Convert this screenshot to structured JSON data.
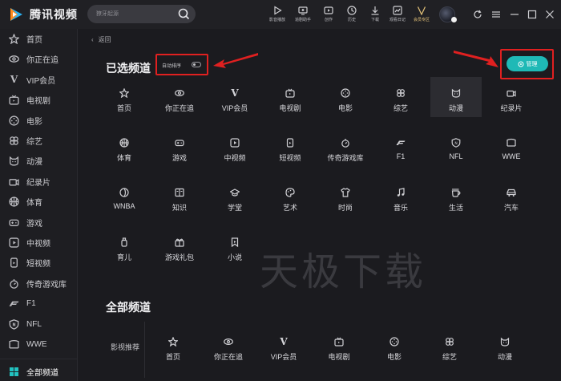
{
  "app": {
    "name": "腾讯视频"
  },
  "search": {
    "placeholder": "獠牙起源"
  },
  "toolbar": [
    {
      "icon": "play-icon",
      "label": "影音播放"
    },
    {
      "icon": "screen-record-icon",
      "label": "追剧助手"
    },
    {
      "icon": "creation-icon",
      "label": "创作"
    },
    {
      "icon": "history-icon",
      "label": "历史"
    },
    {
      "icon": "download-icon",
      "label": "下载"
    },
    {
      "icon": "moments-icon",
      "label": "观看日记"
    },
    {
      "icon": "vip-icon",
      "label": "会员专区"
    }
  ],
  "sidebar": {
    "items": [
      {
        "icon": "star-icon",
        "label": "首页"
      },
      {
        "icon": "eye-icon",
        "label": "你正在追"
      },
      {
        "icon": "vip-icon",
        "label": "VIP会员"
      },
      {
        "icon": "tv-icon",
        "label": "电视剧"
      },
      {
        "icon": "film-icon",
        "label": "电影"
      },
      {
        "icon": "clover-icon",
        "label": "综艺"
      },
      {
        "icon": "cat-icon",
        "label": "动漫"
      },
      {
        "icon": "camera-icon",
        "label": "纪录片"
      },
      {
        "icon": "basketball-icon",
        "label": "体育"
      },
      {
        "icon": "gamepad-icon",
        "label": "游戏"
      },
      {
        "icon": "play-square-icon",
        "label": "中视频"
      },
      {
        "icon": "phone-icon",
        "label": "短视频"
      },
      {
        "icon": "stopwatch-icon",
        "label": "传奇游戏库"
      },
      {
        "icon": "f1-icon",
        "label": "F1"
      },
      {
        "icon": "shield-icon",
        "label": "NFL"
      },
      {
        "icon": "wwe-icon",
        "label": "WWE"
      }
    ],
    "bottom": {
      "icon": "grid-icon",
      "label": "全部频道"
    }
  },
  "main": {
    "back_label": "返回",
    "selected_title": "已选频道",
    "auto_sort_label": "自动排序",
    "manage_label": "管理",
    "selected_channels": [
      {
        "icon": "star-icon",
        "label": "首页"
      },
      {
        "icon": "eye-icon",
        "label": "你正在追"
      },
      {
        "icon": "vip-icon",
        "label": "VIP会员"
      },
      {
        "icon": "tv-icon",
        "label": "电视剧"
      },
      {
        "icon": "film-icon",
        "label": "电影"
      },
      {
        "icon": "clover-icon",
        "label": "综艺"
      },
      {
        "icon": "cat-icon",
        "label": "动漫"
      },
      {
        "icon": "camera-icon",
        "label": "纪录片"
      },
      {
        "icon": "basketball-icon",
        "label": "体育"
      },
      {
        "icon": "gamepad-icon",
        "label": "游戏"
      },
      {
        "icon": "play-square-icon",
        "label": "中视频"
      },
      {
        "icon": "phone-icon",
        "label": "短视频"
      },
      {
        "icon": "stopwatch-icon",
        "label": "传奇游戏库"
      },
      {
        "icon": "f1-icon",
        "label": "F1"
      },
      {
        "icon": "shield-icon",
        "label": "NFL"
      },
      {
        "icon": "wwe-icon",
        "label": "WWE"
      },
      {
        "icon": "wnba-icon",
        "label": "WNBA"
      },
      {
        "icon": "book-icon",
        "label": "知识"
      },
      {
        "icon": "hat-icon",
        "label": "学堂"
      },
      {
        "icon": "palette-icon",
        "label": "艺术"
      },
      {
        "icon": "shirt-icon",
        "label": "时尚"
      },
      {
        "icon": "music-icon",
        "label": "音乐"
      },
      {
        "icon": "cup-icon",
        "label": "生活"
      },
      {
        "icon": "car-icon",
        "label": "汽车"
      },
      {
        "icon": "bottle-icon",
        "label": "育儿"
      },
      {
        "icon": "gift-icon",
        "label": "游戏礼包"
      },
      {
        "icon": "bookmark-icon",
        "label": "小说"
      }
    ],
    "all_title": "全部频道",
    "watermark": "天极下载",
    "all_category": "影视推荐",
    "all_channels": [
      {
        "icon": "star-icon",
        "label": "首页"
      },
      {
        "icon": "eye-icon",
        "label": "你正在追"
      },
      {
        "icon": "vip-icon",
        "label": "VIP会员"
      },
      {
        "icon": "tv-icon",
        "label": "电视剧"
      },
      {
        "icon": "film-icon",
        "label": "电影"
      },
      {
        "icon": "clover-icon",
        "label": "综艺"
      },
      {
        "icon": "cat-icon",
        "label": "动漫"
      }
    ]
  },
  "colors": {
    "accent": "#1fb9b6",
    "annotation": "#e02020",
    "background": "#1b1b1f"
  }
}
